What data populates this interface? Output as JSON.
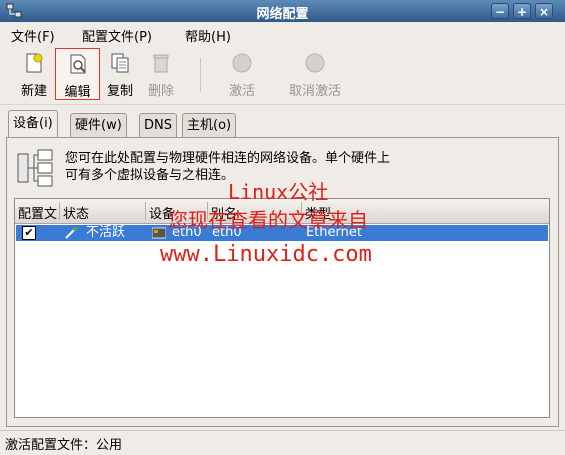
{
  "window": {
    "title": "网络配置",
    "buttons": {
      "minimize": "−",
      "maximize": "+",
      "close": "×"
    }
  },
  "menu": [
    {
      "label": "文件(F)"
    },
    {
      "label": "配置文件(P)"
    },
    {
      "label": "帮助(H)"
    }
  ],
  "toolbar": {
    "new": "新建",
    "edit": "编辑",
    "copy": "复制",
    "delete": "删除",
    "activate": "激活",
    "deactivate": "取消激活"
  },
  "tabs": [
    {
      "label": "设备(i)"
    },
    {
      "label": "硬件(w)"
    },
    {
      "label": "DNS"
    },
    {
      "label": "主机(o)"
    }
  ],
  "description": {
    "line1": "您可在此处配置与物理硬件相连的网络设备。单个硬件上",
    "line2": "可有多个虚拟设备与之相连。"
  },
  "table": {
    "headers": [
      "配置文",
      "状态",
      "设备",
      "别名",
      "类型"
    ],
    "rows": [
      {
        "checked": true,
        "status": "不活跃",
        "device": "eth0",
        "alias": "eth0",
        "type": "Ethernet"
      }
    ]
  },
  "statusbar": {
    "text": "激活配置文件：公用"
  },
  "watermark": {
    "line1": "Linux公社",
    "line2": "您现在查看的文章来自",
    "line3": "www.Linuxidc.com",
    "color": "#e0201a"
  },
  "colors": {
    "selection": "#3a7bd5",
    "titlebar": "#2e5a8a"
  }
}
